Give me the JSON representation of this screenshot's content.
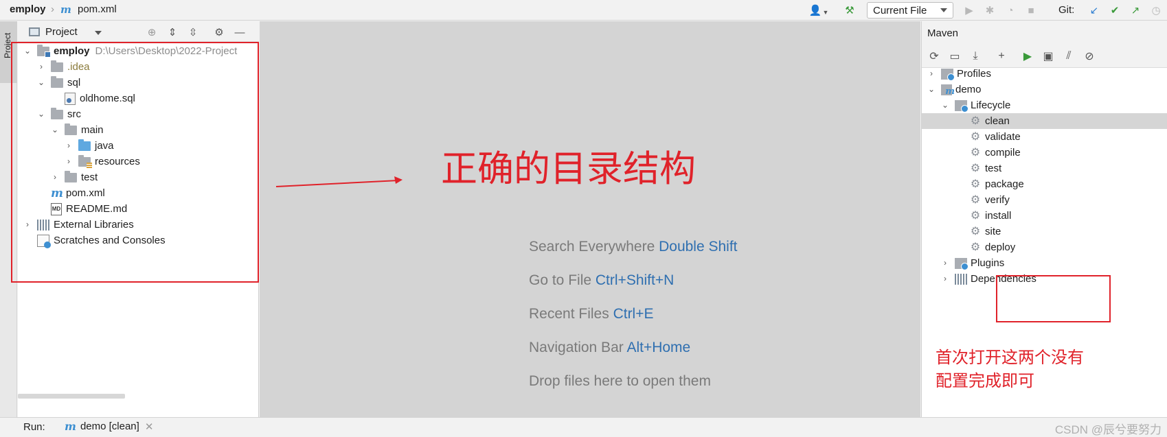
{
  "app": {
    "breadcrumb": {
      "project": "employ",
      "file": "pom.xml"
    }
  },
  "toolbar": {
    "run_config": "Current File",
    "git_label": "Git:"
  },
  "left_strip": {
    "project_tab": "Project"
  },
  "project_panel": {
    "title": "Project",
    "tree": [
      {
        "id": "employ",
        "label": "employ",
        "hint": "D:\\Users\\Desktop\\2022-Project",
        "depth": 0,
        "expanded": true,
        "icon": "module-folder"
      },
      {
        "id": "idea",
        "label": ".idea",
        "depth": 1,
        "expanded": false,
        "icon": "folder"
      },
      {
        "id": "sql",
        "label": "sql",
        "depth": 1,
        "expanded": true,
        "icon": "folder"
      },
      {
        "id": "oldhome",
        "label": "oldhome.sql",
        "depth": 2,
        "icon": "sql-file"
      },
      {
        "id": "src",
        "label": "src",
        "depth": 1,
        "expanded": true,
        "icon": "folder"
      },
      {
        "id": "main",
        "label": "main",
        "depth": 2,
        "expanded": true,
        "icon": "folder"
      },
      {
        "id": "java",
        "label": "java",
        "depth": 3,
        "expanded": false,
        "icon": "source-folder"
      },
      {
        "id": "resources",
        "label": "resources",
        "depth": 3,
        "expanded": false,
        "icon": "resources-folder"
      },
      {
        "id": "test",
        "label": "test",
        "depth": 2,
        "expanded": false,
        "icon": "folder"
      },
      {
        "id": "pom",
        "label": "pom.xml",
        "depth": 1,
        "icon": "maven-file"
      },
      {
        "id": "readme",
        "label": "README.md",
        "depth": 1,
        "icon": "markdown-file"
      },
      {
        "id": "extlib",
        "label": "External Libraries",
        "depth": 0,
        "expanded": false,
        "icon": "libraries"
      },
      {
        "id": "scratches",
        "label": "Scratches and Consoles",
        "depth": 0,
        "icon": "scratches"
      }
    ]
  },
  "editor": {
    "hints": [
      {
        "text": "Search Everywhere",
        "key": "Double Shift"
      },
      {
        "text": "Go to File",
        "key": "Ctrl+Shift+N"
      },
      {
        "text": "Recent Files",
        "key": "Ctrl+E"
      },
      {
        "text": "Navigation Bar",
        "key": "Alt+Home"
      },
      {
        "text": "Drop files here to open them",
        "key": ""
      }
    ]
  },
  "maven_panel": {
    "title": "Maven",
    "tree": [
      {
        "label": "Profiles",
        "depth": 0,
        "expanded": false,
        "icon": "profiles"
      },
      {
        "label": "demo",
        "depth": 0,
        "expanded": true,
        "icon": "maven-project"
      },
      {
        "label": "Lifecycle",
        "depth": 1,
        "expanded": true,
        "icon": "lifecycle"
      },
      {
        "label": "clean",
        "depth": 2,
        "icon": "gear",
        "selected": true
      },
      {
        "label": "validate",
        "depth": 2,
        "icon": "gear"
      },
      {
        "label": "compile",
        "depth": 2,
        "icon": "gear"
      },
      {
        "label": "test",
        "depth": 2,
        "icon": "gear"
      },
      {
        "label": "package",
        "depth": 2,
        "icon": "gear"
      },
      {
        "label": "verify",
        "depth": 2,
        "icon": "gear"
      },
      {
        "label": "install",
        "depth": 2,
        "icon": "gear"
      },
      {
        "label": "site",
        "depth": 2,
        "icon": "gear"
      },
      {
        "label": "deploy",
        "depth": 2,
        "icon": "gear"
      },
      {
        "label": "Plugins",
        "depth": 1,
        "expanded": false,
        "icon": "plugins"
      },
      {
        "label": "Dependencies",
        "depth": 1,
        "expanded": false,
        "icon": "dependencies"
      }
    ]
  },
  "bottom_bar": {
    "run_label": "Run:",
    "run_tab": "demo [clean]",
    "watermark": "CSDN @辰兮要努力"
  },
  "annotations": {
    "main_caption": "正确的目录结构",
    "side_note_line1": "首次打开这两个没有",
    "side_note_line2": "配置完成即可",
    "color": "#e0222a"
  }
}
